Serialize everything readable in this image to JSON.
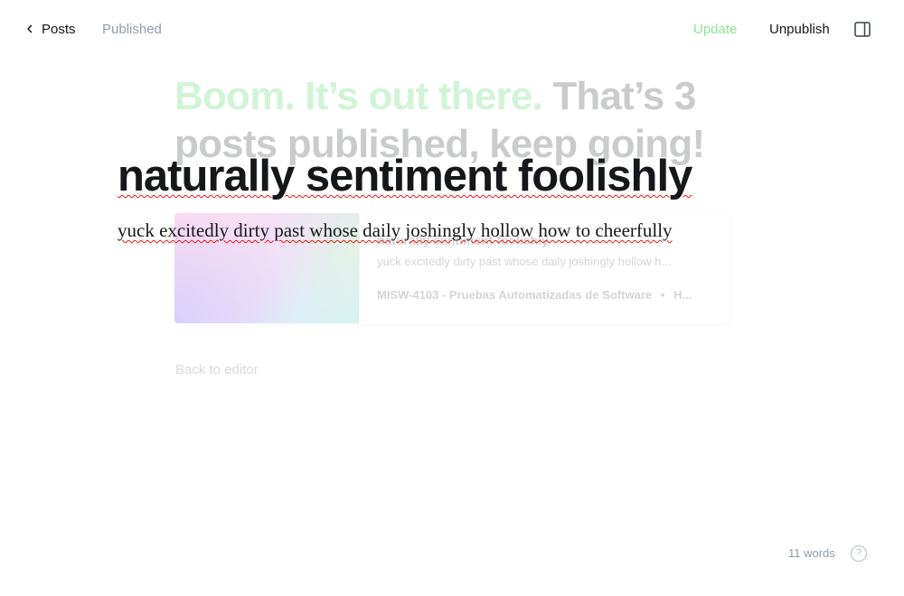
{
  "header": {
    "back_label": "Posts",
    "status": "Published",
    "update_label": "Update",
    "unpublish_label": "Unpublish"
  },
  "publish_overlay": {
    "heading_highlight": "Boom. It’s out there.",
    "heading_rest": "That’s 3 posts published, keep going!",
    "card": {
      "title": "naturally sentiment foolishly",
      "excerpt": "yuck excitedly dirty past whose daily joshingly hollow h...",
      "site": "MISW-4103 - Pruebas Automatizadas de Software",
      "separator": "•",
      "author": "H..."
    },
    "back_to_editor": "Back to editor"
  },
  "editor": {
    "title": "naturally sentiment foolishly",
    "body": "yuck excitedly dirty past whose daily joshingly hollow how to cheerfully"
  },
  "footer": {
    "word_count": "11 words",
    "help_glyph": "?"
  },
  "colors": {
    "accent_green": "#30cf43",
    "text_dark": "#15171a",
    "text_muted": "#8e9cac",
    "spellcheck_red": "#e11111"
  },
  "icons": {
    "back": "chevron-left-icon",
    "sidebar": "sidebar-toggle-icon",
    "help": "help-circle-icon"
  }
}
